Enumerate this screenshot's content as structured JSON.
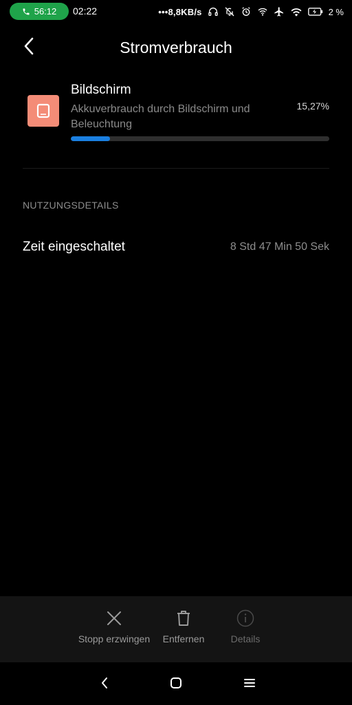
{
  "status_bar": {
    "call_timer": "56:12",
    "clock": "02:22",
    "net_speed": "8,8KB/s",
    "battery_percent": "2 %",
    "icons": [
      "phone-icon",
      "headset-icon",
      "muted-bell-icon",
      "alarm-icon",
      "wifi-hotspot-icon",
      "airplane-icon",
      "wifi-icon",
      "battery-charging-icon"
    ]
  },
  "header": {
    "title": "Stromverbrauch",
    "back_icon": "chevron-left-icon"
  },
  "usage": {
    "app_name": "Bildschirm",
    "description": "Akkuverbrauch durch Bildschirm und Beleuchtung",
    "percent_label": "15,27%",
    "percent_value": 0.1527,
    "icon": "screen-icon",
    "icon_color": "#f48c77",
    "bar_color": "#1a7fe0"
  },
  "details": {
    "heading": "NUTZUNGSDETAILS",
    "rows": [
      {
        "label": "Zeit eingeschaltet",
        "value": "8 Std 47 Min 50 Sek"
      }
    ]
  },
  "actions": [
    {
      "label": "Stopp erzwingen",
      "icon": "close-icon",
      "enabled": true
    },
    {
      "label": "Entfernen",
      "icon": "trash-icon",
      "enabled": true
    },
    {
      "label": "Details",
      "icon": "info-icon",
      "enabled": false
    }
  ],
  "nav": {
    "back_icon": "nav-back-icon",
    "home_icon": "nav-home-icon",
    "menu_icon": "nav-menu-icon"
  }
}
